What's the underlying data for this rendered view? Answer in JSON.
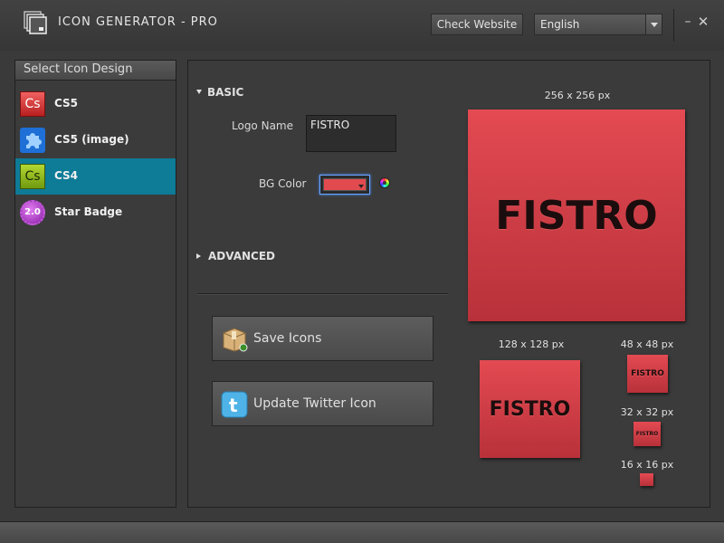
{
  "app": {
    "title": "ICON GENERATOR - PRO",
    "check_website_label": "Check Website",
    "language": "English",
    "minimize_glyph": "–",
    "close_glyph": "✕"
  },
  "sidebar": {
    "header": "Select Icon Design",
    "items": [
      {
        "label": "CS5",
        "icon": "adobe-cs5-icon",
        "selected": false
      },
      {
        "label": "CS5 (image)",
        "icon": "puzzle-icon",
        "selected": false
      },
      {
        "label": "CS4",
        "icon": "adobe-cs4-icon",
        "selected": true
      },
      {
        "label": "Star Badge",
        "icon": "star-badge-icon",
        "selected": false
      }
    ],
    "cs_glyph": "Cs",
    "badge_glyph": "2.0"
  },
  "basic": {
    "header": "BASIC",
    "logo_name_label": "Logo Name",
    "logo_name_value": "FISTRO",
    "bg_color_label": "BG Color",
    "bg_color": "#e14a4f"
  },
  "advanced": {
    "header": "ADVANCED"
  },
  "actions": {
    "save_label": "Save Icons",
    "twitter_label": "Update Twitter Icon"
  },
  "previews": {
    "text": "FISTRO",
    "sizes": [
      {
        "label": "256 x 256 px"
      },
      {
        "label": "128 x 128 px"
      },
      {
        "label": "48 x 48 px"
      },
      {
        "label": "32 x 32 px"
      },
      {
        "label": "16 x 16 px"
      }
    ]
  },
  "colors": {
    "selected_row": "#0e7b97",
    "icon_red": "#e14a4f"
  }
}
